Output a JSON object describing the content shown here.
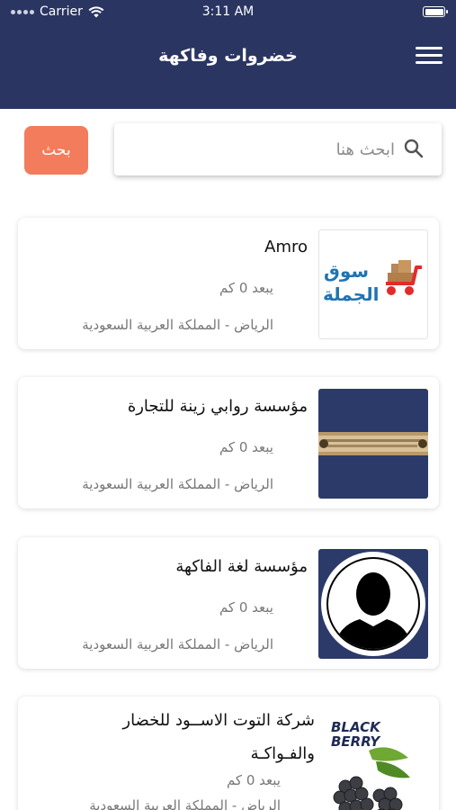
{
  "status_bar": {
    "carrier": "Carrier",
    "time": "3:11 AM"
  },
  "header": {
    "title": "خضروات وفاكهة"
  },
  "search": {
    "placeholder": "ابحث هنا",
    "button_label": "بحث"
  },
  "stores": [
    {
      "name": "Amro",
      "distance": "يبعد 0 كم",
      "location": "الرياض - المملكة العربية السعودية",
      "logo_text_top": "سوق",
      "logo_text_bottom": "الجملة"
    },
    {
      "name": "مؤسسة روابي زينة للتجارة",
      "distance": "يبعد 0 كم",
      "location": "الرياض - المملكة العربية السعودية"
    },
    {
      "name": "مؤسسة لغة الفاكهة",
      "distance": "يبعد 0 كم",
      "location": "الرياض - المملكة العربية السعودية"
    },
    {
      "name_line1": "شركة التوت الاســود للخضار",
      "name_line2": "والفـواكـة",
      "distance": "يبعد 0 كم",
      "location": "الرياض - المملكة العربية السعودية",
      "logo_text": "BLACK BERRY"
    }
  ],
  "colors": {
    "header_bg": "#2a3562",
    "accent": "#f27c5c",
    "card_thumb_navy": "#2c3a6a"
  }
}
